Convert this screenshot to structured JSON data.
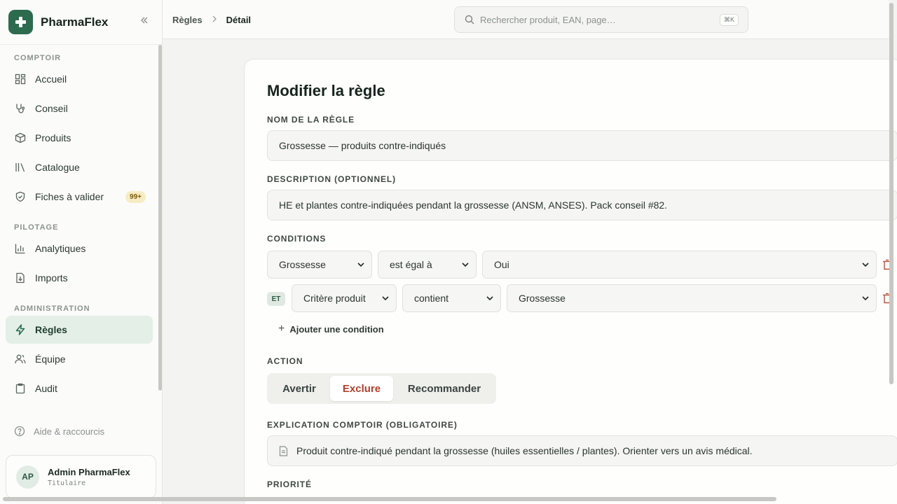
{
  "app": {
    "name": "PharmaFlex"
  },
  "sidebar": {
    "sections": [
      {
        "title": "COMPTOIR"
      },
      {
        "title": "PILOTAGE"
      },
      {
        "title": "ADMINISTRATION"
      }
    ],
    "items": [
      {
        "label": "Accueil",
        "icon": "dashboard-icon"
      },
      {
        "label": "Conseil",
        "icon": "stethoscope-icon"
      },
      {
        "label": "Produits",
        "icon": "package-icon"
      },
      {
        "label": "Catalogue",
        "icon": "library-icon"
      },
      {
        "label": "Fiches à valider",
        "icon": "shield-check-icon",
        "badge": "99+"
      },
      {
        "label": "Analytiques",
        "icon": "bar-chart-icon"
      },
      {
        "label": "Imports",
        "icon": "file-download-icon"
      },
      {
        "label": "Règles",
        "icon": "lightning-icon",
        "active": true
      },
      {
        "label": "Équipe",
        "icon": "users-icon"
      },
      {
        "label": "Audit",
        "icon": "clipboard-icon"
      }
    ],
    "help_label": "Aide & raccourcis",
    "user": {
      "initials": "AP",
      "name": "Admin PharmaFlex",
      "role": "Titulaire"
    }
  },
  "topbar": {
    "breadcrumb": [
      "Règles",
      "Détail"
    ],
    "search_placeholder": "Rechercher produit, EAN, page…",
    "search_shortcut": "⌘K"
  },
  "form": {
    "title": "Modifier la règle",
    "name_label": "NOM DE LA RÈGLE",
    "name_value": "Grossesse — produits contre-indiqués",
    "description_label": "DESCRIPTION (OPTIONNEL)",
    "description_value": "HE et plantes contre-indiquées pendant la grossesse (ANSM, ANSES). Pack conseil #82.",
    "conditions_label": "CONDITIONS",
    "conditions": [
      {
        "field": "Grossesse",
        "operator": "est égal à",
        "value": "Oui"
      },
      {
        "connector": "ET",
        "field": "Critère produit",
        "operator": "contient",
        "value": "Grossesse"
      }
    ],
    "add_condition_label": "Ajouter une condition",
    "action_label": "ACTION",
    "actions": [
      "Avertir",
      "Exclure",
      "Recommander"
    ],
    "selected_action": "Exclure",
    "explanation_label": "EXPLICATION COMPTOIR (OBLIGATOIRE)",
    "explanation_value": "Produit contre-indiqué pendant la grossesse (huiles essentielles / plantes). Orienter vers un avis médical.",
    "priority_label": "PRIORITÉ"
  },
  "colors": {
    "brand": "#2d6b4f",
    "danger": "#b23e2d",
    "active_bg": "#e3efe7"
  }
}
